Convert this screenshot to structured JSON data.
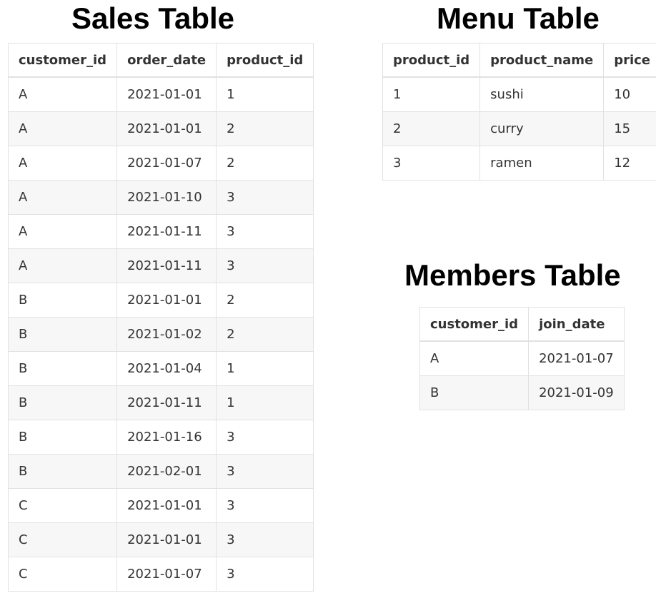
{
  "sales": {
    "title": "Sales Table",
    "headers": [
      "customer_id",
      "order_date",
      "product_id"
    ],
    "rows": [
      [
        "A",
        "2021-01-01",
        "1"
      ],
      [
        "A",
        "2021-01-01",
        "2"
      ],
      [
        "A",
        "2021-01-07",
        "2"
      ],
      [
        "A",
        "2021-01-10",
        "3"
      ],
      [
        "A",
        "2021-01-11",
        "3"
      ],
      [
        "A",
        "2021-01-11",
        "3"
      ],
      [
        "B",
        "2021-01-01",
        "2"
      ],
      [
        "B",
        "2021-01-02",
        "2"
      ],
      [
        "B",
        "2021-01-04",
        "1"
      ],
      [
        "B",
        "2021-01-11",
        "1"
      ],
      [
        "B",
        "2021-01-16",
        "3"
      ],
      [
        "B",
        "2021-02-01",
        "3"
      ],
      [
        "C",
        "2021-01-01",
        "3"
      ],
      [
        "C",
        "2021-01-01",
        "3"
      ],
      [
        "C",
        "2021-01-07",
        "3"
      ]
    ]
  },
  "menu": {
    "title": "Menu Table",
    "headers": [
      "product_id",
      "product_name",
      "price"
    ],
    "rows": [
      [
        "1",
        "sushi",
        "10"
      ],
      [
        "2",
        "curry",
        "15"
      ],
      [
        "3",
        "ramen",
        "12"
      ]
    ]
  },
  "members": {
    "title": "Members Table",
    "headers": [
      "customer_id",
      "join_date"
    ],
    "rows": [
      [
        "A",
        "2021-01-07"
      ],
      [
        "B",
        "2021-01-09"
      ]
    ]
  }
}
